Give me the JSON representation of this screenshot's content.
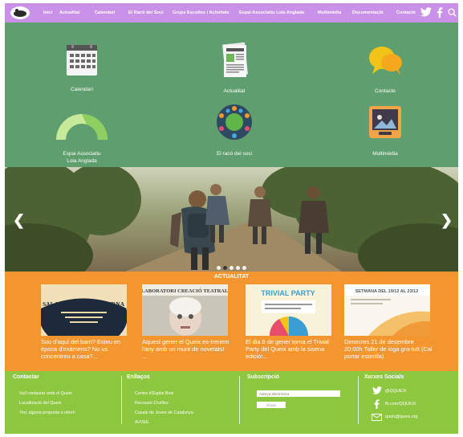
{
  "nav": {
    "items": [
      "Inici",
      "Actualitat",
      "Calendari",
      "El Racó del Soci",
      "Grups Escoltes i Activitats",
      "Espai Associatiu Lola Anglada",
      "Multimèdia",
      "Documentació",
      "Contacte"
    ],
    "icons": [
      "twitter-icon",
      "facebook-icon",
      "search-icon"
    ]
  },
  "grid": {
    "tiles": [
      {
        "label": "Calendari",
        "icon": "calendar-icon"
      },
      {
        "label": "Actualitat",
        "icon": "newspaper-icon"
      },
      {
        "label": "Contacte",
        "icon": "speech-bubbles-icon"
      },
      {
        "label": "Espai Associatiu",
        "label2": "Lola Anglada",
        "icon": "arch-icon"
      },
      {
        "label": "El racó del soci",
        "icon": "people-circle-icon"
      },
      {
        "label": "Multimèdia",
        "icon": "media-icon"
      }
    ]
  },
  "hero": {
    "slides": 5,
    "active": 2
  },
  "news": {
    "title": "ACTUALITAT",
    "cards": [
      {
        "text": "Sou d'aquí del barri? Esteu en època d'exàmens? No us concentreu a casa?...",
        "image_text": "SALA D'ESTUDI NOCTURNA"
      },
      {
        "text": "Aquest gener el Queix es-trenem l'any amb un munt de novetats! ...",
        "image_text": "LABORATORI CREACIÓ TEATRAL"
      },
      {
        "text": "El dia 8 de gener torna el Trivial Party del Queix amb la sisena edició!...",
        "image_text": "TRIVIAL PARTY"
      },
      {
        "text": "Dimecres 21 de desembre 20:00h Taller de ioga gra-tuït (Cal portar esterilla)",
        "image_text": "SETMANA DEL 19/12 AL 23/12"
      }
    ]
  },
  "footer": {
    "contact": {
      "title": "Contactar",
      "links": [
        "Vull contactar amb el Queix",
        "Localització del Queix",
        "Tinc alguna proposta a oferir!"
      ]
    },
    "links": {
      "title": "Enllaços",
      "links": [
        "Centre d'Esplai Boix",
        "Recreant Cruïlles",
        "Casals de Joves de Catalunya",
        "AVVEE"
      ]
    },
    "subscribe": {
      "title": "Subscripció",
      "placeholder": "Adreça electrònica",
      "button": "Envia"
    },
    "social": {
      "title": "Xarxes Socials",
      "items": [
        {
          "icon": "twitter-icon",
          "text": "@QQUEIX"
        },
        {
          "icon": "facebook-icon",
          "text": "fb.com/QQUEIX"
        },
        {
          "icon": "mail-icon",
          "text": "queix@queix.org"
        }
      ]
    }
  }
}
